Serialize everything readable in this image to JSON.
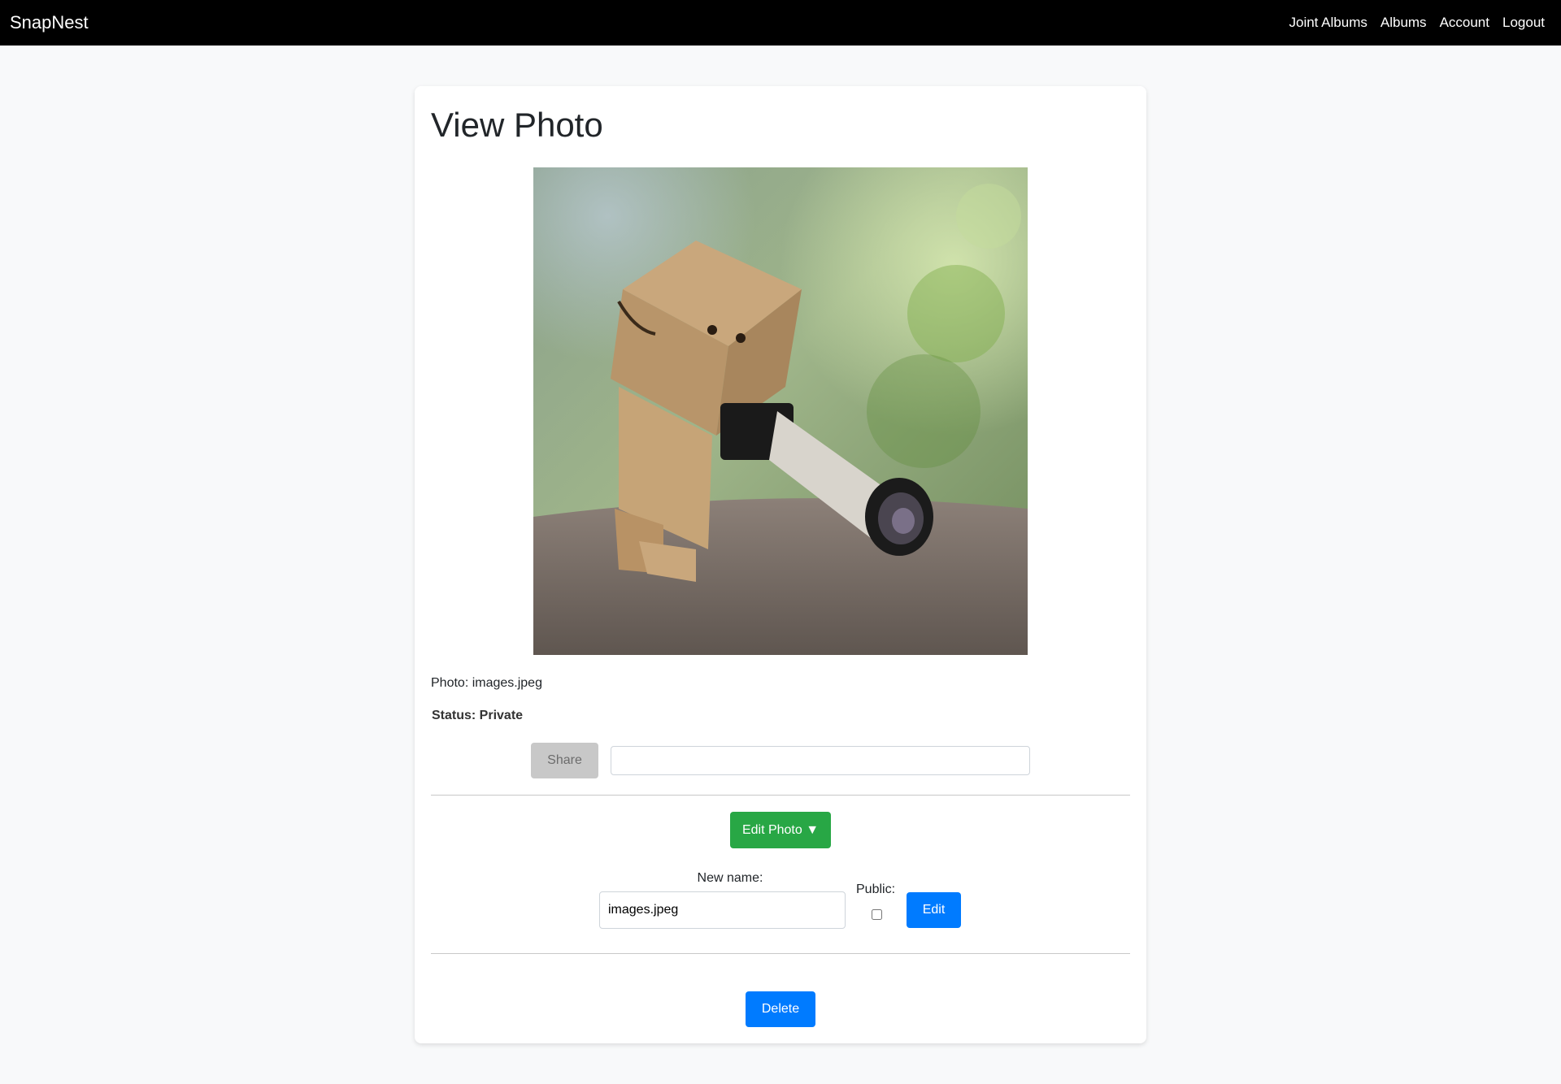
{
  "nav": {
    "brand": "SnapNest",
    "links": [
      "Joint Albums",
      "Albums",
      "Account",
      "Logout"
    ]
  },
  "page": {
    "title": "View Photo",
    "photo_label": "Photo: images.jpeg",
    "status_label": "Status: Private"
  },
  "share": {
    "button_label": "Share",
    "input_value": ""
  },
  "edit": {
    "toggle_label": "Edit Photo ▼",
    "new_name_label": "New name:",
    "new_name_value": "images.jpeg",
    "public_label": "Public:",
    "public_checked": false,
    "submit_label": "Edit"
  },
  "delete": {
    "button_label": "Delete"
  },
  "colors": {
    "navbar": "#000000",
    "edit_photo_button": "#28a745",
    "primary_button": "#007bff",
    "share_button_disabled": "#c8c8c8"
  }
}
